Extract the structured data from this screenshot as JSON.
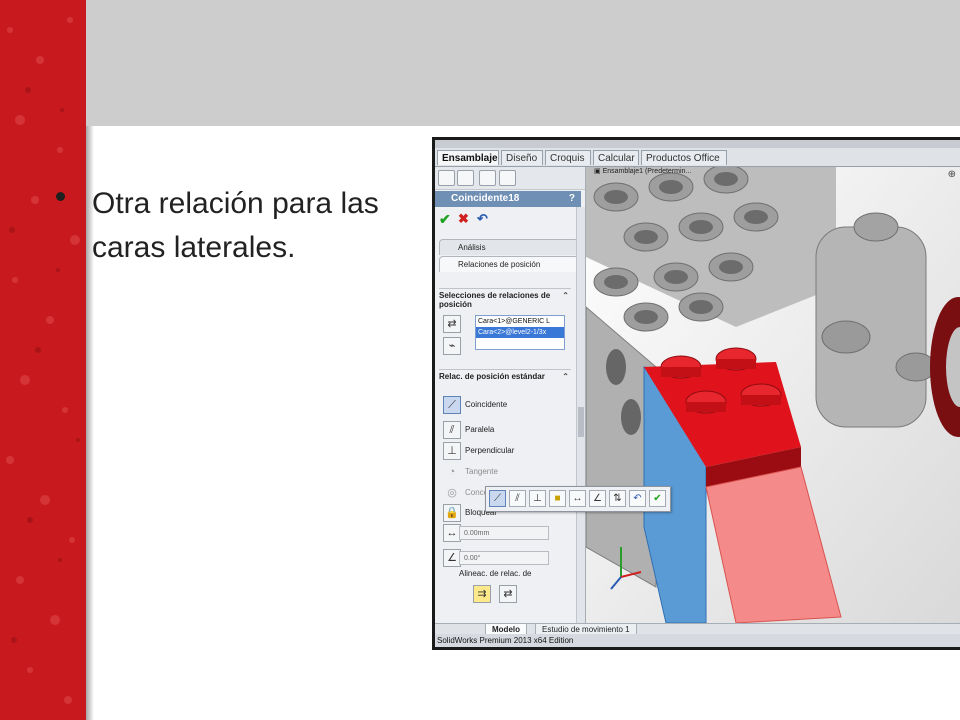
{
  "colors": {
    "accent_red": "#c81a1e",
    "topbar_gray": "#cdcdcd",
    "lego_red": "#e0121b",
    "lego_gray": "#b8b8b8",
    "highlight_blue": "#5b9bd5",
    "selected_face_pink": "#f58a8a"
  },
  "slide": {
    "bullet_text": "Otra relación para las caras laterales."
  },
  "app": {
    "ribbon_tabs": [
      "Ensamblaje",
      "Diseño",
      "Croquis",
      "Calcular",
      "Productos Office"
    ],
    "panel": {
      "title": "Coincidente18",
      "help": "?",
      "tab_analysis": "Análisis",
      "tab_mates": "Relaciones de posición",
      "selections_header": "Selecciones de relaciones de posición",
      "selections": [
        "Cara<1>@GENERIC L",
        "Cara<2>@level2-1/3x"
      ],
      "standard_header": "Relac. de posición estándar",
      "relations": [
        {
          "label": "Coincidente",
          "icon": "coincident-icon"
        },
        {
          "label": "Paralela",
          "icon": "parallel-icon"
        },
        {
          "label": "Perpendicular",
          "icon": "perpendicular-icon"
        },
        {
          "label": "Tangente",
          "icon": "tangent-icon"
        },
        {
          "label": "Concéntrica",
          "icon": "concentric-icon"
        },
        {
          "label": "Bloquear",
          "icon": "lock-icon"
        }
      ],
      "distance_value": "0.00mm",
      "angle_value": "0.00°",
      "alignment_label": "Alineac. de relac. de"
    },
    "viewport": {
      "tree_label": "Ensamblaje1 (Predetermin..."
    },
    "bottom_tabs": [
      "Modelo",
      "Estudio de movimiento 1"
    ],
    "status_text": "SolidWorks Premium 2013 x64 Edition"
  }
}
